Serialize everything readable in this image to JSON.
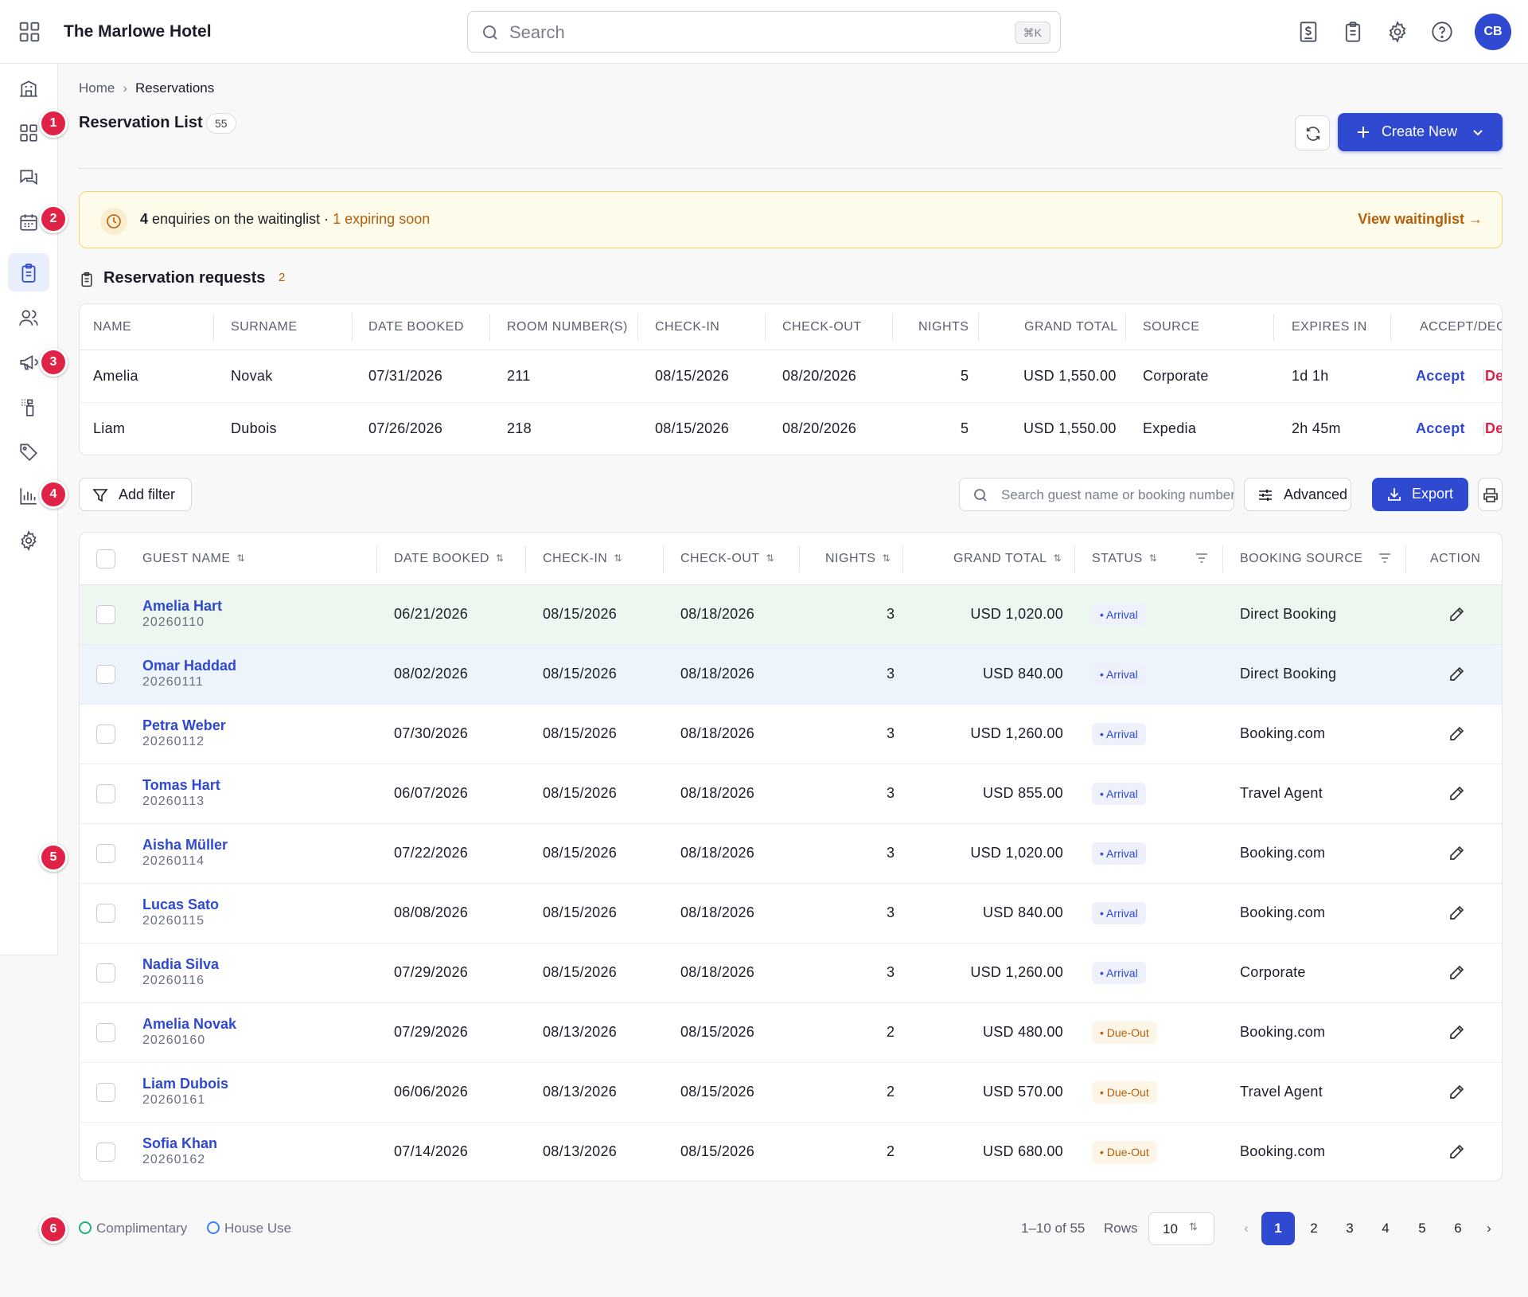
{
  "header": {
    "title": "The Marlowe Hotel",
    "search_placeholder": "Search",
    "search_shortcut": "⌘K",
    "avatar_initials": "CB"
  },
  "breadcrumb": {
    "home": "Home",
    "current": "Reservations"
  },
  "page": {
    "title": "Reservation List",
    "count": "55",
    "create_label": "Create New"
  },
  "annotations": [
    "1",
    "2",
    "3",
    "4",
    "5",
    "6"
  ],
  "banner": {
    "count": "4",
    "text": " enquiries on the waitinglist · ",
    "warning": "1 expiring soon",
    "link": "View waitinglist"
  },
  "requests": {
    "title": "Reservation requests",
    "count": "2",
    "columns": [
      "NAME",
      "SURNAME",
      "DATE BOOKED",
      "ROOM NUMBER(S)",
      "CHECK-IN",
      "CHECK-OUT",
      "NIGHTS",
      "GRAND TOTAL",
      "SOURCE",
      "EXPIRES IN",
      "ACCEPT/DECLINE"
    ],
    "accept_label": "Accept",
    "decline_label": "Decline",
    "rows": [
      {
        "name": "Amelia",
        "surname": "Novak",
        "booked": "07/31/2026",
        "rooms": "211",
        "checkin": "08/15/2026",
        "checkout": "08/20/2026",
        "nights": "5",
        "total": "USD 1,550.00",
        "source": "Corporate",
        "expires": "1d 1h"
      },
      {
        "name": "Liam",
        "surname": "Dubois",
        "booked": "07/26/2026",
        "rooms": "218",
        "checkin": "08/15/2026",
        "checkout": "08/20/2026",
        "nights": "5",
        "total": "USD 1,550.00",
        "source": "Expedia",
        "expires": "2h 45m"
      }
    ]
  },
  "toolbar": {
    "filter_label": "Add filter",
    "search_placeholder": "Search guest name or booking number",
    "advanced_label": "Advanced",
    "export_label": "Export"
  },
  "table": {
    "columns": [
      "GUEST NAME",
      "DATE BOOKED",
      "CHECK-IN",
      "CHECK-OUT",
      "NIGHTS",
      "GRAND TOTAL",
      "STATUS",
      "BOOKING SOURCE",
      "ACTION"
    ],
    "rows": [
      {
        "name": "Amelia Hart",
        "id": "20260110",
        "booked": "06/21/2026",
        "checkin": "08/15/2026",
        "checkout": "08/18/2026",
        "nights": "3",
        "total": "USD 1,020.00",
        "status": "Arrival",
        "source": "Direct Booking",
        "tint": "#edf7f0"
      },
      {
        "name": "Omar Haddad",
        "id": "20260111",
        "booked": "08/02/2026",
        "checkin": "08/15/2026",
        "checkout": "08/18/2026",
        "nights": "3",
        "total": "USD 840.00",
        "status": "Arrival",
        "source": "Direct Booking",
        "tint": "#eef4fb"
      },
      {
        "name": "Petra Weber",
        "id": "20260112",
        "booked": "07/30/2026",
        "checkin": "08/15/2026",
        "checkout": "08/18/2026",
        "nights": "3",
        "total": "USD 1,260.00",
        "status": "Arrival",
        "source": "Booking.com",
        "tint": "#ffffff"
      },
      {
        "name": "Tomas Hart",
        "id": "20260113",
        "booked": "06/07/2026",
        "checkin": "08/15/2026",
        "checkout": "08/18/2026",
        "nights": "3",
        "total": "USD 855.00",
        "status": "Arrival",
        "source": "Travel Agent",
        "tint": "#ffffff"
      },
      {
        "name": "Aisha Müller",
        "id": "20260114",
        "booked": "07/22/2026",
        "checkin": "08/15/2026",
        "checkout": "08/18/2026",
        "nights": "3",
        "total": "USD 1,020.00",
        "status": "Arrival",
        "source": "Booking.com",
        "tint": "#ffffff"
      },
      {
        "name": "Lucas Sato",
        "id": "20260115",
        "booked": "08/08/2026",
        "checkin": "08/15/2026",
        "checkout": "08/18/2026",
        "nights": "3",
        "total": "USD 840.00",
        "status": "Arrival",
        "source": "Booking.com",
        "tint": "#ffffff"
      },
      {
        "name": "Nadia Silva",
        "id": "20260116",
        "booked": "07/29/2026",
        "checkin": "08/15/2026",
        "checkout": "08/18/2026",
        "nights": "3",
        "total": "USD 1,260.00",
        "status": "Arrival",
        "source": "Corporate",
        "tint": "#ffffff"
      },
      {
        "name": "Amelia Novak",
        "id": "20260160",
        "booked": "07/29/2026",
        "checkin": "08/13/2026",
        "checkout": "08/15/2026",
        "nights": "2",
        "total": "USD 480.00",
        "status": "Due-Out",
        "source": "Booking.com",
        "tint": "#ffffff"
      },
      {
        "name": "Liam Dubois",
        "id": "20260161",
        "booked": "06/06/2026",
        "checkin": "08/13/2026",
        "checkout": "08/15/2026",
        "nights": "2",
        "total": "USD 570.00",
        "status": "Due-Out",
        "source": "Travel Agent",
        "tint": "#ffffff"
      },
      {
        "name": "Sofia Khan",
        "id": "20260162",
        "booked": "07/14/2026",
        "checkin": "08/13/2026",
        "checkout": "08/15/2026",
        "nights": "2",
        "total": "USD 680.00",
        "status": "Due-Out",
        "source": "Booking.com",
        "tint": "#ffffff"
      }
    ]
  },
  "legend": [
    {
      "label": "Complimentary",
      "color": "#22b07d"
    },
    {
      "label": "House Use",
      "color": "#3b82f6"
    }
  ],
  "pagination": {
    "info": "1–10 of 55",
    "rows_label": "Rows",
    "rows_value": "10",
    "pages": [
      "1",
      "2",
      "3",
      "4",
      "5",
      "6"
    ],
    "current": "1"
  }
}
